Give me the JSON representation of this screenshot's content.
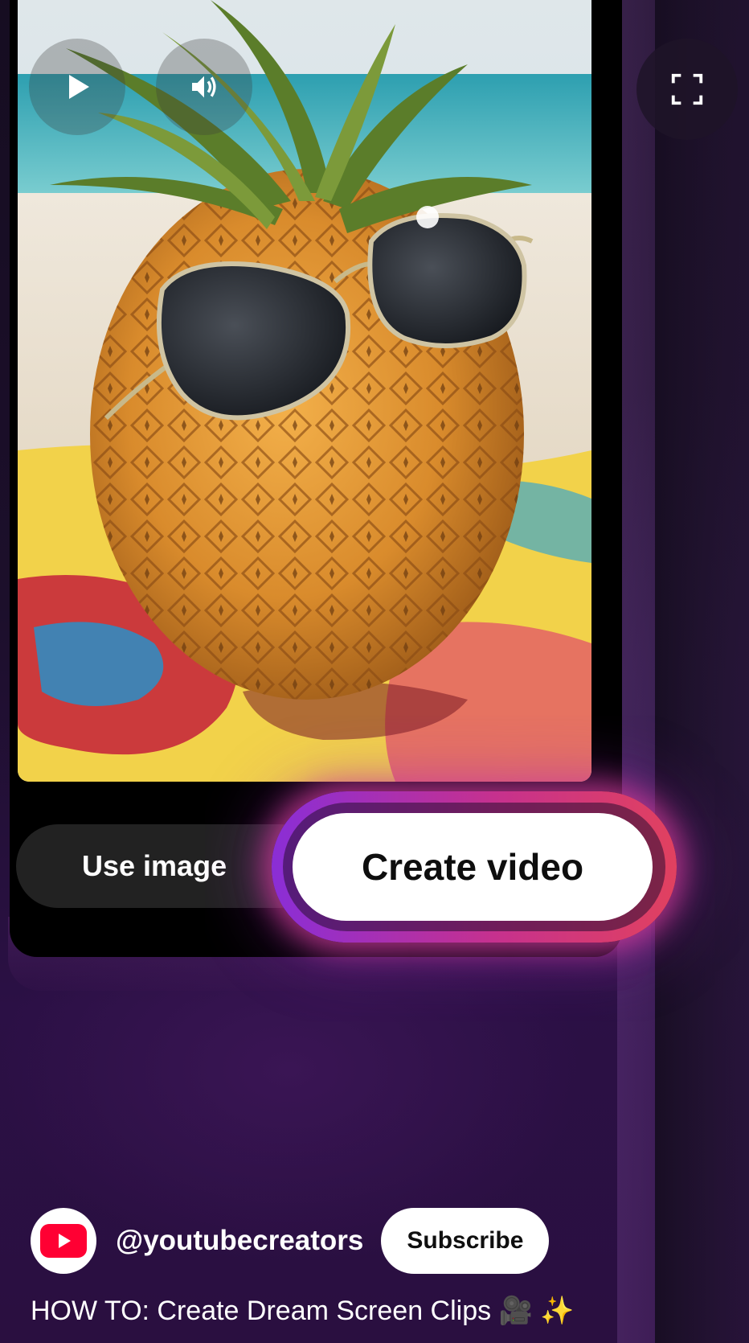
{
  "player": {
    "play_icon": "play-icon",
    "volume_icon": "volume-icon",
    "fullscreen_icon": "fullscreen-icon"
  },
  "actions": {
    "use_image_label": "Use image",
    "create_video_label": "Create video"
  },
  "channel": {
    "handle": "@youtubecreators",
    "subscribe_label": "Subscribe",
    "logo_icon": "youtube-logo-icon"
  },
  "video": {
    "title": "HOW TO: Create Dream Screen Clips 🎥 ✨"
  },
  "colors": {
    "glow_start": "#8a2ed6",
    "glow_end": "#e1415f",
    "youtube_red": "#ff0033",
    "background": "#1c0f2b"
  }
}
